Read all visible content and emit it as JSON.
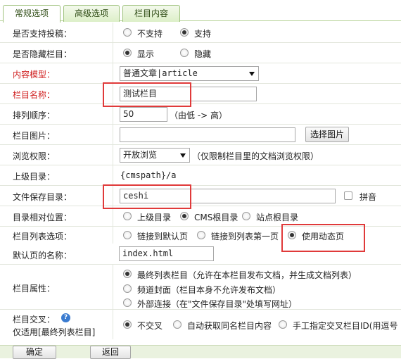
{
  "tabs": [
    {
      "label": "常规选项",
      "active": true
    },
    {
      "label": "高级选项",
      "active": false
    },
    {
      "label": "栏目内容",
      "active": false
    }
  ],
  "rows": {
    "submit": {
      "label": "是否支持投稿：",
      "options": [
        "不支持",
        "支持"
      ],
      "selected": "支持"
    },
    "hidden": {
      "label": "是否隐藏栏目：",
      "options": [
        "显示",
        "隐藏"
      ],
      "selected": "显示"
    },
    "content_model": {
      "label": "内容模型：",
      "value": "普通文章|article"
    },
    "category_name": {
      "label": "栏目名称：",
      "value": "测试栏目"
    },
    "sort_order": {
      "label": "排列顺序：",
      "value": "50",
      "hint": "（由低 -> 高）"
    },
    "category_image": {
      "label": "栏目图片：",
      "value": "",
      "button": "选择图片"
    },
    "browse_permission": {
      "label": "浏览权限：",
      "value": "开放浏览",
      "hint": "（仅限制栏目里的文档浏览权限）"
    },
    "parent_dir": {
      "label": "上级目录：",
      "value": "{cmspath}/a"
    },
    "save_dir": {
      "label": "文件保存目录：",
      "value": "ceshi",
      "pinyin_label": "拼音"
    },
    "dir_relative": {
      "label": "目录相对位置：",
      "options": [
        "上级目录",
        "CMS根目录",
        "站点根目录"
      ],
      "selected": "CMS根目录"
    },
    "list_options": {
      "label": "栏目列表选项：",
      "options": [
        "链接到默认页",
        "链接到列表第一页",
        "使用动态页"
      ],
      "selected": "使用动态页"
    },
    "default_page": {
      "label": "默认页的名称：",
      "value": "index.html"
    },
    "category_attr": {
      "label": "栏目属性：",
      "options": [
        "最终列表栏目（允许在本栏目发布文档，并生成文档列表）",
        "频道封面（栏目本身不允许发布文档）",
        "外部连接（在\"文件保存目录\"处填写网址）"
      ],
      "selected": "最终列表栏目（允许在本栏目发布文档，并生成文档列表）"
    },
    "cross": {
      "label": "栏目交叉：",
      "sublabel": "仅适用[最终列表栏目]",
      "help_icon": "?",
      "options": [
        "不交叉",
        "自动获取同名栏目内容",
        "手工指定交叉栏目ID(用逗号"
      ],
      "selected": "不交叉"
    }
  },
  "footer": {
    "confirm_label": "确定",
    "back_label": "返回"
  },
  "colors": {
    "highlight": "#e03a3a",
    "required_label": "#d02020",
    "tab_border": "#9fc27e"
  }
}
